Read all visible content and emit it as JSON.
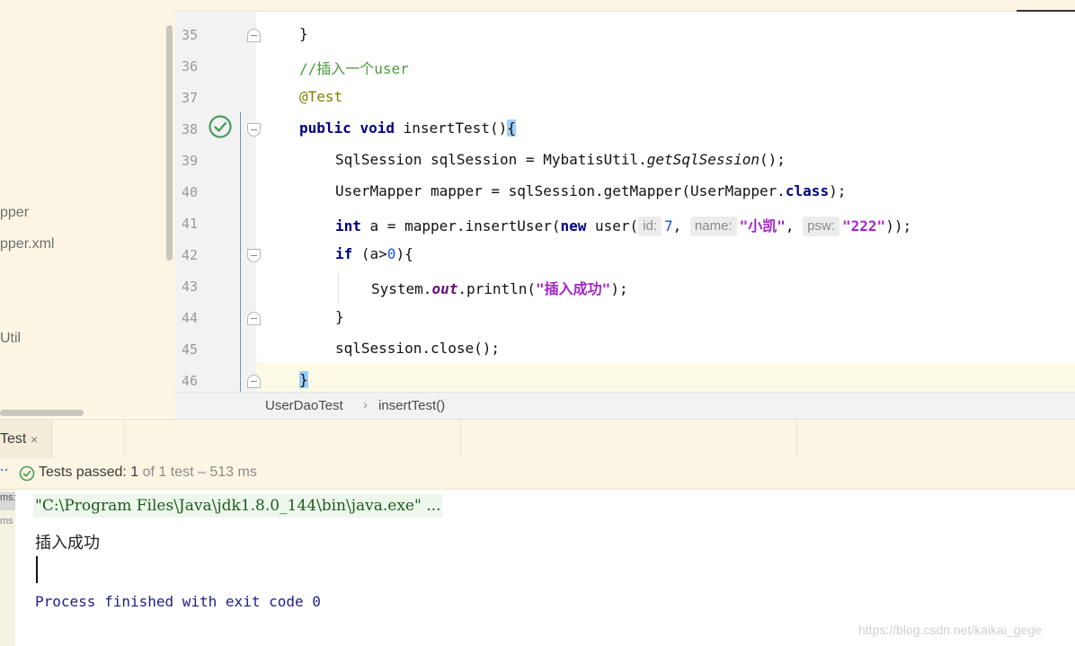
{
  "sidebar": {
    "items": [
      {
        "label": "pper"
      },
      {
        "label": "pper.xml"
      },
      {
        "label": "Util"
      }
    ]
  },
  "editor": {
    "lines": [
      {
        "num": "35"
      },
      {
        "num": "36"
      },
      {
        "num": "37"
      },
      {
        "num": "38"
      },
      {
        "num": "39"
      },
      {
        "num": "40"
      },
      {
        "num": "41"
      },
      {
        "num": "42"
      },
      {
        "num": "43"
      },
      {
        "num": "44"
      },
      {
        "num": "45"
      },
      {
        "num": "46"
      }
    ],
    "code": {
      "l35_brace": "}",
      "l36_comment": "//插入一个user",
      "l37_annotation": "@Test",
      "l38_kw_public": "public",
      "l38_kw_void": "void",
      "l38_method": "insertTest()",
      "l38_brace": "{",
      "l39_decl": "SqlSession sqlSession = MybatisUtil.",
      "l39_call": "getSqlSession",
      "l39_end": "();",
      "l40_decl": "UserMapper mapper = sqlSession.getMapper(UserMapper.",
      "l40_kw": "class",
      "l40_end": ");",
      "l41_kw_int": "int",
      "l41_mid": " a = mapper.insertUser(",
      "l41_kw_new": "new",
      "l41_ctor": " user(",
      "l41_hint_id": "id:",
      "l41_val_id": "7",
      "l41_comma1": ", ",
      "l41_hint_name": "name:",
      "l41_val_name": "\"小凯\"",
      "l41_comma2": ", ",
      "l41_hint_psw": "psw:",
      "l41_val_psw": "\"222\"",
      "l41_end": "));",
      "l42_kw_if": "if",
      "l42_cond_a": " (a>",
      "l42_zero": "0",
      "l42_cond_b": "){",
      "l43_call": "System.",
      "l43_field": "out",
      "l43_print": ".println(",
      "l43_str": "\"插入成功\"",
      "l43_end": ");",
      "l44_brace": "}",
      "l45_call": "sqlSession.close();",
      "l46_brace": "}"
    }
  },
  "breadcrumb": {
    "class_name": "UserDaoTest",
    "separator": "›",
    "method_name": "insertTest()"
  },
  "run_panel": {
    "tab_label": "Test",
    "tab_close": "×",
    "status": {
      "dots": "··",
      "passed_label": "Tests passed:",
      "passed_count": "1",
      "of_total": "of 1 test",
      "duration": "– 513 ms"
    },
    "left_strip": {
      "chip": "ms:",
      "ms": "ms"
    },
    "console": {
      "command_line": "\"C:\\Program Files\\Java\\jdk1.8.0_144\\bin\\java.exe\" ...",
      "output_line": "插入成功",
      "exit_line": "Process finished with exit code 0"
    }
  },
  "watermark": "https://blog.csdn.net/kaikai_gege",
  "colors": {
    "sidebar_bg": "#fcf5e3",
    "gutter_bg": "#f2f2f2",
    "keyword": "#000080",
    "comment": "#4c9a3d",
    "annotation": "#808000",
    "string": "#a524c8",
    "number": "#1750eb",
    "test_pass_green": "#4a9c5d",
    "console_blue": "#1d1d8a"
  },
  "icons": {
    "gutter_run": "run-test-passed-icon",
    "status_check": "check-circle-icon",
    "tab_close": "close-icon"
  }
}
